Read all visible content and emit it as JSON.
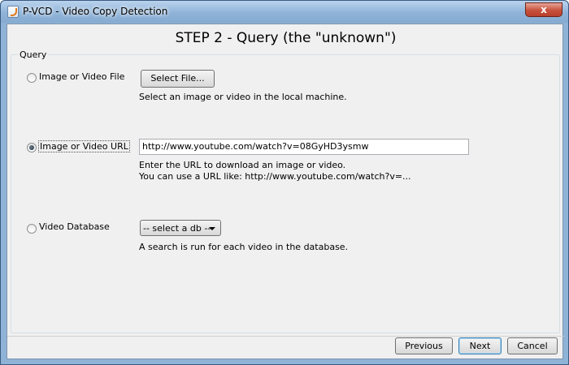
{
  "window": {
    "title": "P-VCD - Video Copy Detection",
    "close_label": "x"
  },
  "step_title": "STEP 2 - Query (the \"unknown\")",
  "query": {
    "group_label": "Query",
    "options": [
      {
        "label": "Image or Video File",
        "selected": false,
        "button_label": "Select File...",
        "description": "Select an image or video in the local machine."
      },
      {
        "label": "Image or Video URL",
        "selected": true,
        "input_value": "http://www.youtube.com/watch?v=08GyHD3ysmw",
        "description_line1": "Enter the URL to download an image or video.",
        "description_line2": "You can use a URL like: http://www.youtube.com/watch?v=..."
      },
      {
        "label": "Video Database",
        "selected": false,
        "select_value": "-- select a db --",
        "description": "A search is run for each video in the database."
      }
    ]
  },
  "footer": {
    "previous_label": "Previous",
    "next_label": "Next",
    "cancel_label": "Cancel"
  }
}
